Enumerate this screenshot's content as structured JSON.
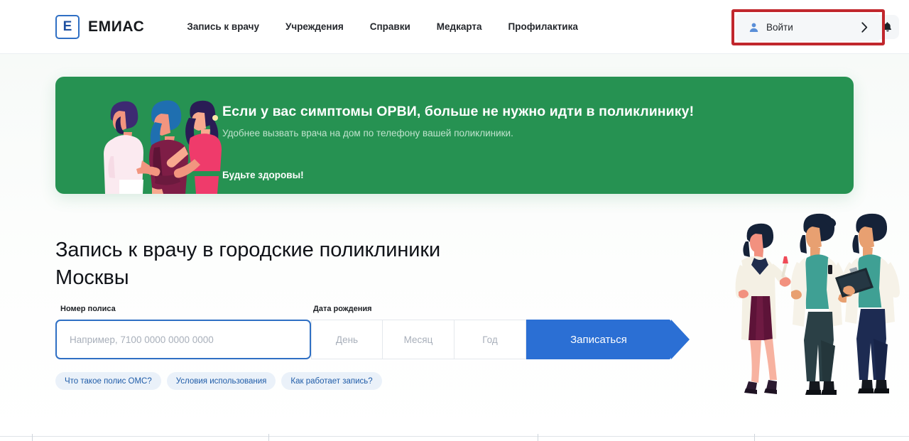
{
  "header": {
    "logo": {
      "mark_letter": "Е",
      "wordmark": "ЕМИАС",
      "icon": "emias-logo-icon"
    },
    "nav": [
      {
        "label": "Запись к врачу"
      },
      {
        "label": "Учреждения"
      },
      {
        "label": "Справки"
      },
      {
        "label": "Медкарта"
      },
      {
        "label": "Профилактика"
      }
    ],
    "bell_icon": "bell-icon",
    "login": {
      "label": "Войти",
      "user_icon": "user-icon",
      "chevron_icon": "chevron-right-icon",
      "highlight_color": "#c1272d",
      "highlighted": true
    }
  },
  "banner": {
    "title": "Если у вас симптомы ОРВИ, больше не нужно идти в поликлинику!",
    "subtitle": "Удобнее вызвать врача на дом по телефону вашей поликлиники.",
    "cta": "Будьте здоровы!",
    "bg_color": "#269252",
    "illustration": "family-illustration"
  },
  "hero": {
    "title": "Запись к врачу в городские поликлиники Москвы",
    "illustration": "three-doctors-illustration"
  },
  "form": {
    "polis": {
      "label": "Номер полиса",
      "placeholder": "Например, 7100 0000 0000 0000",
      "value": "",
      "focused": true,
      "focus_color": "#2f6fc4"
    },
    "dob": {
      "label": "Дата рождения",
      "day": {
        "placeholder": "День",
        "value": ""
      },
      "month": {
        "placeholder": "Месяц",
        "value": ""
      },
      "year": {
        "placeholder": "Год",
        "value": ""
      }
    },
    "submit": {
      "label": "Записаться",
      "color": "#2b6fd4"
    }
  },
  "chips": [
    {
      "label": "Что такое полис ОМС?"
    },
    {
      "label": "Условия использования"
    },
    {
      "label": "Как работает запись?"
    }
  ]
}
